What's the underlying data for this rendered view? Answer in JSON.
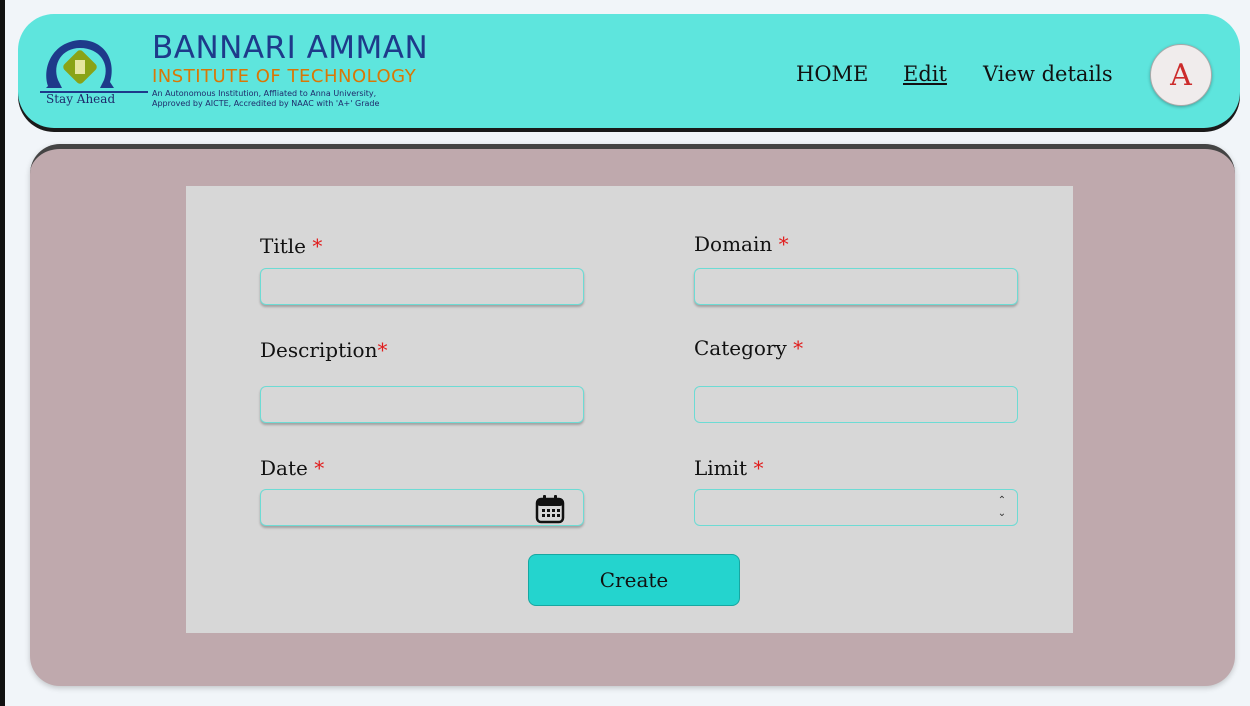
{
  "header": {
    "logo": {
      "tagline": "Stay Ahead",
      "name_line1": "BANNARI AMMAN",
      "name_line2": "INSTITUTE OF TECHNOLOGY",
      "sub_line1": "An Autonomous Institution, Affliated to Anna University,",
      "sub_line2": "Approved by AICTE, Accredited by NAAC with 'A+' Grade"
    },
    "nav": {
      "home": "HOME",
      "edit": "Edit",
      "view_details": "View details"
    },
    "avatar_letter": "A"
  },
  "form": {
    "title_label": "Title",
    "domain_label": "Domain",
    "description_label": "Description",
    "category_label": "Category",
    "date_label": "Date",
    "limit_label": "Limit",
    "required_mark": "*",
    "create_label": "Create"
  },
  "colors": {
    "header_bg": "#5ee5dd",
    "panel_bg": "#bfa9ad",
    "card_bg": "#d7d7d7",
    "button_bg": "#24d4ce",
    "required": "#e11d1d"
  },
  "icons": {
    "date_picker": "calendar-icon",
    "limit_spinner": "spinner-arrows-icon"
  }
}
